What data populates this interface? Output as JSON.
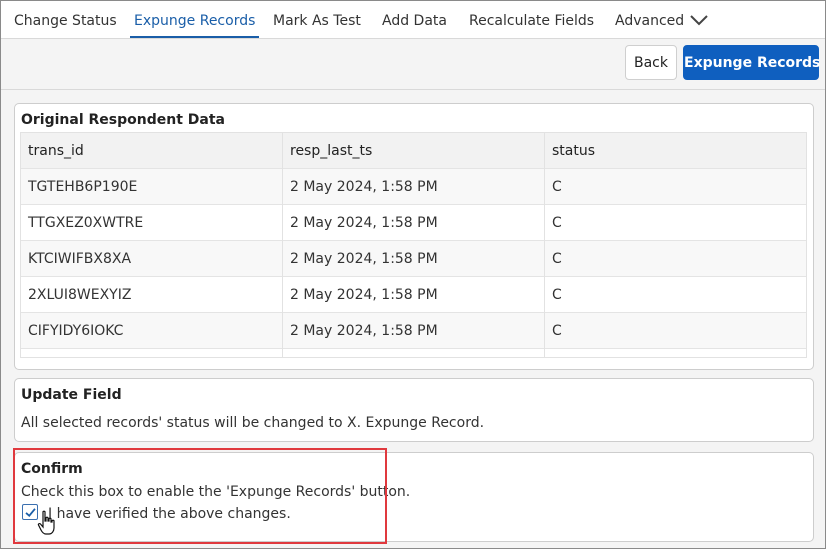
{
  "tabs": [
    {
      "label": "Change Status",
      "active": false
    },
    {
      "label": "Expunge Records",
      "active": true
    },
    {
      "label": "Mark As Test",
      "active": false
    },
    {
      "label": "Add Data",
      "active": false
    },
    {
      "label": "Recalculate Fields",
      "active": false
    },
    {
      "label": "Advanced",
      "active": false,
      "icon": "chevron-down-icon"
    }
  ],
  "actions": {
    "back_label": "Back",
    "primary_label": "Expunge Records"
  },
  "original_data": {
    "title": "Original Respondent Data",
    "columns": [
      "trans_id",
      "resp_last_ts",
      "status"
    ],
    "rows": [
      [
        "TGTEHB6P190E",
        "2 May 2024, 1:58 PM",
        "C"
      ],
      [
        "TTGXEZ0XWTRE",
        "2 May 2024, 1:58 PM",
        "C"
      ],
      [
        "KTCIWIFBX8XA",
        "2 May 2024, 1:58 PM",
        "C"
      ],
      [
        "2XLUI8WEXYIZ",
        "2 May 2024, 1:58 PM",
        "C"
      ],
      [
        "CIFYIDY6IOKC",
        "2 May 2024, 1:58 PM",
        "C"
      ],
      [
        "",
        "",
        ""
      ]
    ]
  },
  "update_field": {
    "title": "Update Field",
    "text": "All selected records' status will be changed to X. Expunge Record."
  },
  "confirm": {
    "title": "Confirm",
    "instruction": "Check this box to enable the 'Expunge Records' button.",
    "checkbox_label": "I have verified the above changes.",
    "checked": true
  },
  "colors": {
    "accent": "#1a5ea8",
    "primary_button": "#0f5fbf",
    "highlight": "#e0393e"
  }
}
